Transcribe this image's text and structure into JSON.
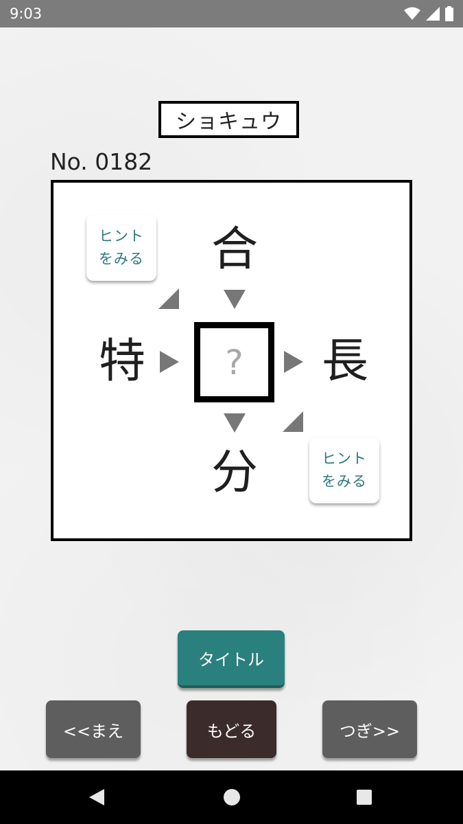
{
  "status_bar": {
    "time": "9:03"
  },
  "level_label": "ショキュウ",
  "puzzle_number": "No. 0182",
  "board": {
    "top": "合",
    "left": "特",
    "right": "長",
    "bottom": "分",
    "answer_placeholder": "?",
    "hint_top_left": {
      "line1": "ヒント",
      "line2": "をみる"
    },
    "hint_bottom_right": {
      "line1": "ヒント",
      "line2": "をみる"
    }
  },
  "buttons": {
    "title": "タイトル",
    "prev": "<<まえ",
    "back": "もどる",
    "next": "つぎ>>"
  },
  "colors": {
    "accent": "#2a807d",
    "hint_text": "#2e7878",
    "back_button": "#3b2b2b",
    "nav_button": "#5e5e5e",
    "arrow": "#777777"
  }
}
